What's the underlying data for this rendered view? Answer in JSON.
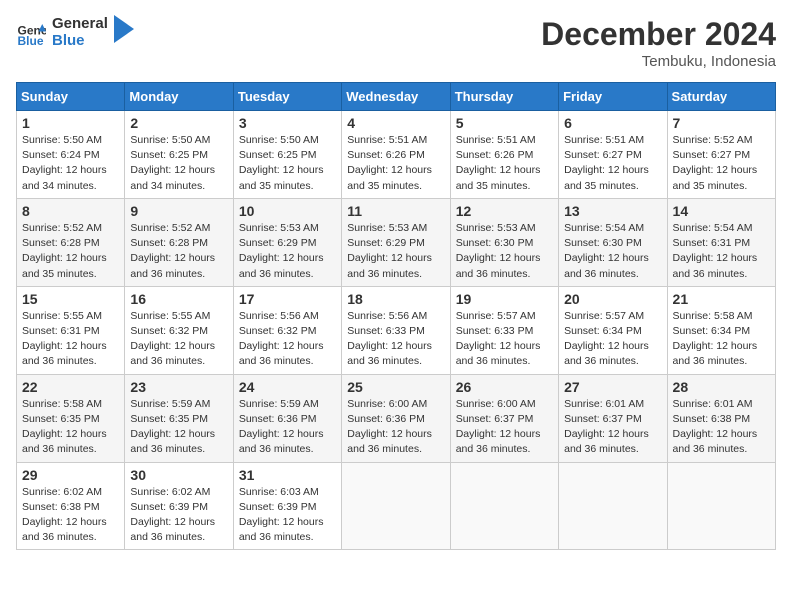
{
  "header": {
    "logo_text_general": "General",
    "logo_text_blue": "Blue",
    "month_title": "December 2024",
    "location": "Tembuku, Indonesia"
  },
  "calendar": {
    "days_of_week": [
      "Sunday",
      "Monday",
      "Tuesday",
      "Wednesday",
      "Thursday",
      "Friday",
      "Saturday"
    ],
    "weeks": [
      [
        {
          "day": "1",
          "sunrise": "5:50 AM",
          "sunset": "6:24 PM",
          "daylight": "12 hours and 34 minutes."
        },
        {
          "day": "2",
          "sunrise": "5:50 AM",
          "sunset": "6:25 PM",
          "daylight": "12 hours and 34 minutes."
        },
        {
          "day": "3",
          "sunrise": "5:50 AM",
          "sunset": "6:25 PM",
          "daylight": "12 hours and 35 minutes."
        },
        {
          "day": "4",
          "sunrise": "5:51 AM",
          "sunset": "6:26 PM",
          "daylight": "12 hours and 35 minutes."
        },
        {
          "day": "5",
          "sunrise": "5:51 AM",
          "sunset": "6:26 PM",
          "daylight": "12 hours and 35 minutes."
        },
        {
          "day": "6",
          "sunrise": "5:51 AM",
          "sunset": "6:27 PM",
          "daylight": "12 hours and 35 minutes."
        },
        {
          "day": "7",
          "sunrise": "5:52 AM",
          "sunset": "6:27 PM",
          "daylight": "12 hours and 35 minutes."
        }
      ],
      [
        {
          "day": "8",
          "sunrise": "5:52 AM",
          "sunset": "6:28 PM",
          "daylight": "12 hours and 35 minutes."
        },
        {
          "day": "9",
          "sunrise": "5:52 AM",
          "sunset": "6:28 PM",
          "daylight": "12 hours and 36 minutes."
        },
        {
          "day": "10",
          "sunrise": "5:53 AM",
          "sunset": "6:29 PM",
          "daylight": "12 hours and 36 minutes."
        },
        {
          "day": "11",
          "sunrise": "5:53 AM",
          "sunset": "6:29 PM",
          "daylight": "12 hours and 36 minutes."
        },
        {
          "day": "12",
          "sunrise": "5:53 AM",
          "sunset": "6:30 PM",
          "daylight": "12 hours and 36 minutes."
        },
        {
          "day": "13",
          "sunrise": "5:54 AM",
          "sunset": "6:30 PM",
          "daylight": "12 hours and 36 minutes."
        },
        {
          "day": "14",
          "sunrise": "5:54 AM",
          "sunset": "6:31 PM",
          "daylight": "12 hours and 36 minutes."
        }
      ],
      [
        {
          "day": "15",
          "sunrise": "5:55 AM",
          "sunset": "6:31 PM",
          "daylight": "12 hours and 36 minutes."
        },
        {
          "day": "16",
          "sunrise": "5:55 AM",
          "sunset": "6:32 PM",
          "daylight": "12 hours and 36 minutes."
        },
        {
          "day": "17",
          "sunrise": "5:56 AM",
          "sunset": "6:32 PM",
          "daylight": "12 hours and 36 minutes."
        },
        {
          "day": "18",
          "sunrise": "5:56 AM",
          "sunset": "6:33 PM",
          "daylight": "12 hours and 36 minutes."
        },
        {
          "day": "19",
          "sunrise": "5:57 AM",
          "sunset": "6:33 PM",
          "daylight": "12 hours and 36 minutes."
        },
        {
          "day": "20",
          "sunrise": "5:57 AM",
          "sunset": "6:34 PM",
          "daylight": "12 hours and 36 minutes."
        },
        {
          "day": "21",
          "sunrise": "5:58 AM",
          "sunset": "6:34 PM",
          "daylight": "12 hours and 36 minutes."
        }
      ],
      [
        {
          "day": "22",
          "sunrise": "5:58 AM",
          "sunset": "6:35 PM",
          "daylight": "12 hours and 36 minutes."
        },
        {
          "day": "23",
          "sunrise": "5:59 AM",
          "sunset": "6:35 PM",
          "daylight": "12 hours and 36 minutes."
        },
        {
          "day": "24",
          "sunrise": "5:59 AM",
          "sunset": "6:36 PM",
          "daylight": "12 hours and 36 minutes."
        },
        {
          "day": "25",
          "sunrise": "6:00 AM",
          "sunset": "6:36 PM",
          "daylight": "12 hours and 36 minutes."
        },
        {
          "day": "26",
          "sunrise": "6:00 AM",
          "sunset": "6:37 PM",
          "daylight": "12 hours and 36 minutes."
        },
        {
          "day": "27",
          "sunrise": "6:01 AM",
          "sunset": "6:37 PM",
          "daylight": "12 hours and 36 minutes."
        },
        {
          "day": "28",
          "sunrise": "6:01 AM",
          "sunset": "6:38 PM",
          "daylight": "12 hours and 36 minutes."
        }
      ],
      [
        {
          "day": "29",
          "sunrise": "6:02 AM",
          "sunset": "6:38 PM",
          "daylight": "12 hours and 36 minutes."
        },
        {
          "day": "30",
          "sunrise": "6:02 AM",
          "sunset": "6:39 PM",
          "daylight": "12 hours and 36 minutes."
        },
        {
          "day": "31",
          "sunrise": "6:03 AM",
          "sunset": "6:39 PM",
          "daylight": "12 hours and 36 minutes."
        },
        null,
        null,
        null,
        null
      ]
    ],
    "labels": {
      "sunrise": "Sunrise:",
      "sunset": "Sunset:",
      "daylight": "Daylight:"
    }
  }
}
